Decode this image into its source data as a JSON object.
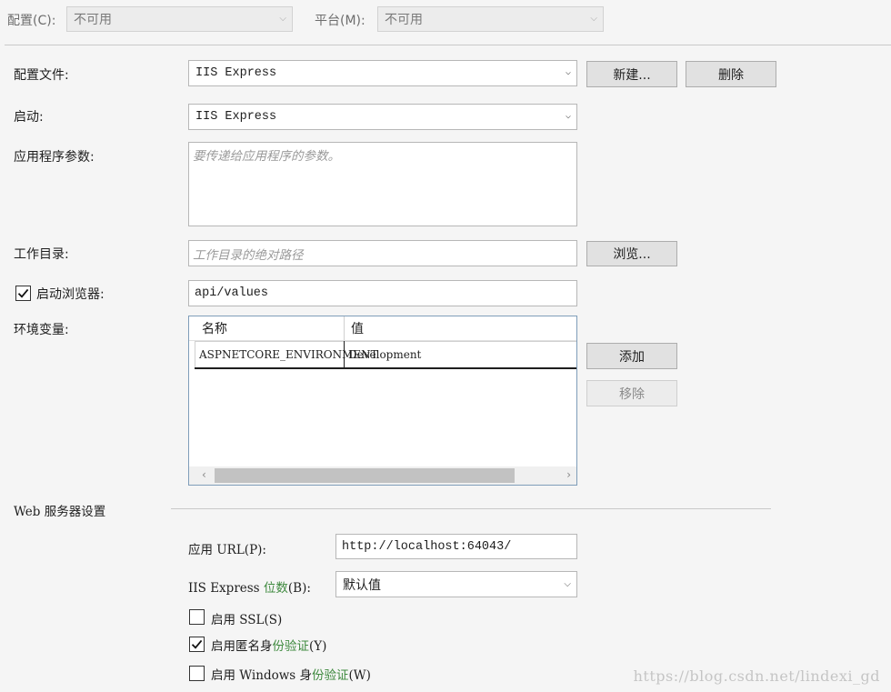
{
  "top": {
    "config_label": "配置(C):",
    "config_value": "不可用",
    "platform_label": "平台(M):",
    "platform_value": "不可用"
  },
  "profile": {
    "label": "配置文件:",
    "value": "IIS Express",
    "new_button": "新建...",
    "delete_button": "删除"
  },
  "launch": {
    "label": "启动:",
    "value": "IIS Express"
  },
  "app_args": {
    "label": "应用程序参数:",
    "placeholder": "要传递给应用程序的参数。"
  },
  "working_dir": {
    "label": "工作目录:",
    "placeholder": "工作目录的绝对路径",
    "browse_button": "浏览..."
  },
  "launch_browser": {
    "label": "启动浏览器:",
    "checked": true,
    "value": "api/values"
  },
  "env_vars": {
    "label": "环境变量:",
    "columns": [
      "名称",
      "值"
    ],
    "rows": [
      {
        "name": "ASPNETCORE_ENVIRONMENT",
        "value": "Development"
      }
    ],
    "add_button": "添加",
    "remove_button": "移除"
  },
  "web_server": {
    "section_title": "Web 服务器设置",
    "app_url_label_prefix": "应用 URL(P):",
    "app_url_value": "http://localhost:64043/",
    "bitness_label_prefix": "IIS Express ",
    "bitness_label_highlight": "位数",
    "bitness_label_suffix": "(B):",
    "bitness_value": "默认值",
    "ssl": {
      "label": "启用 SSL(S)",
      "checked": false
    },
    "anon_auth": {
      "label_prefix": "启用匿名身",
      "label_highlight": "份验证",
      "label_suffix": "(Y)",
      "checked": true
    },
    "win_auth": {
      "label_prefix": "启用 Windows 身",
      "label_highlight": "份验证",
      "label_suffix": "(W)",
      "checked": false
    }
  },
  "watermark": "https://blog.csdn.net/lindexi_gd",
  "icons": {
    "dropdown": "chevron-down-icon",
    "check": "check-icon"
  }
}
